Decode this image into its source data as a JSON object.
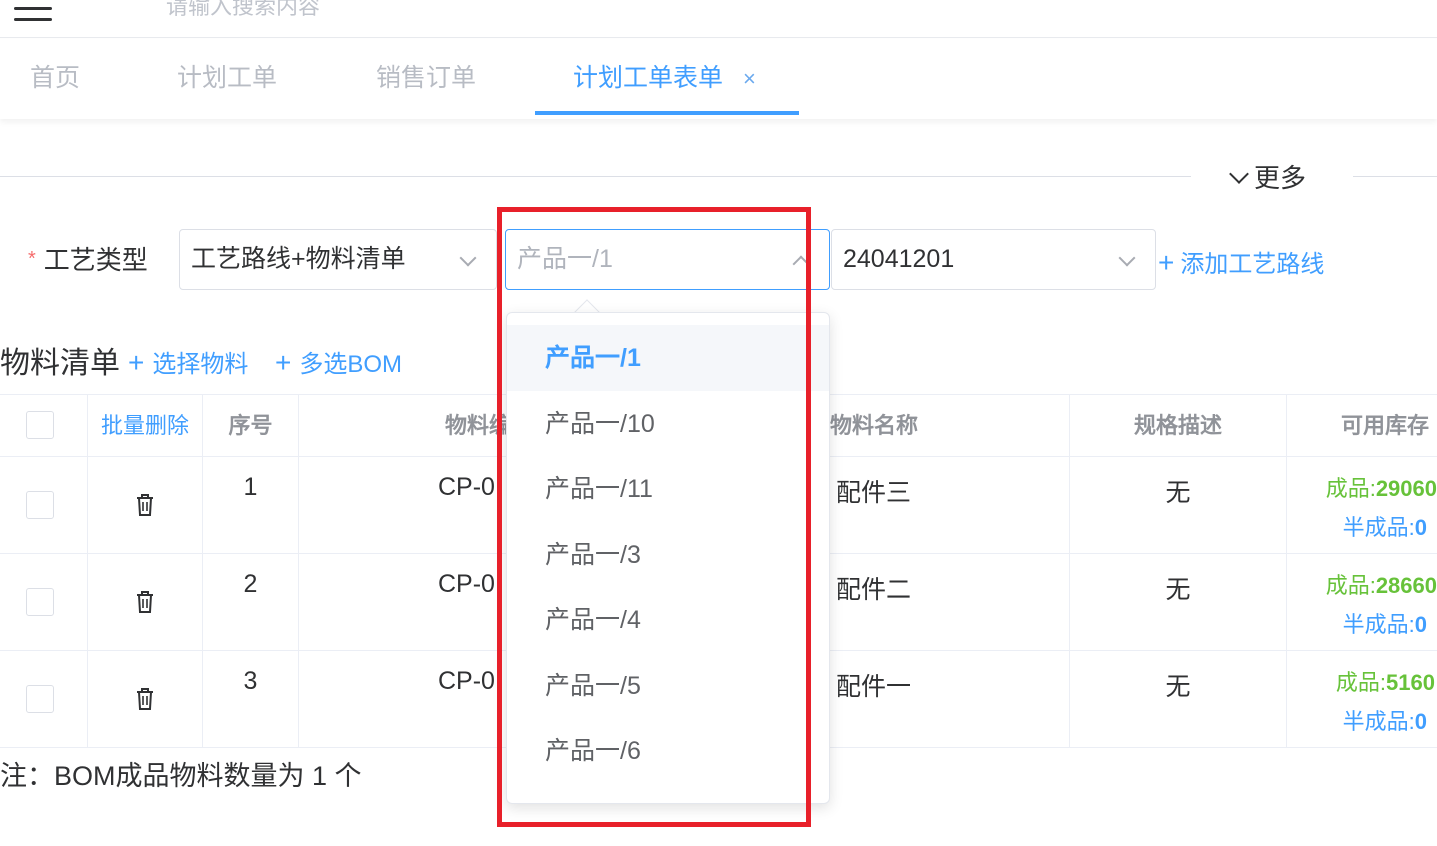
{
  "header": {
    "search_placeholder": "请输入搜索内容"
  },
  "tabs": [
    {
      "label": "首页"
    },
    {
      "label": "计划工单"
    },
    {
      "label": "销售订单"
    },
    {
      "label": "计划工单表单",
      "close": "×"
    }
  ],
  "more_label": "更多",
  "form": {
    "required_mark": "*",
    "label": "工艺类型",
    "route_select": "工艺路线+物料清单",
    "product_select_placeholder": "产品一/1",
    "code_select": "24041201",
    "add_route": "添加工艺路线",
    "plus": "+"
  },
  "section": {
    "title": "物料清单",
    "select_material": "选择物料",
    "multi_bom": "多选BOM"
  },
  "table": {
    "headers": {
      "batch_delete": "批量删除",
      "index": "序号",
      "code": "物料编",
      "name": "物料名称",
      "spec": "规格描述",
      "stock": "可用库存"
    },
    "rows": [
      {
        "index": "1",
        "code": "CP-0",
        "name": "配件三",
        "spec": "无",
        "finished_label": "成品:",
        "finished_value": "29060",
        "semi_label": "半成品:",
        "semi_value": "0"
      },
      {
        "index": "2",
        "code": "CP-0",
        "name": "配件二",
        "spec": "无",
        "finished_label": "成品:",
        "finished_value": "28660",
        "semi_label": "半成品:",
        "semi_value": "0"
      },
      {
        "index": "3",
        "code": "CP-0",
        "name": "配件一",
        "spec": "无",
        "finished_label": "成品:",
        "finished_value": "5160",
        "semi_label": "半成品:",
        "semi_value": "0"
      }
    ]
  },
  "note": "注：BOM成品物料数量为 1 个",
  "dropdown": {
    "options": [
      "产品一/1",
      "产品一/10",
      "产品一/11",
      "产品一/3",
      "产品一/4",
      "产品一/5",
      "产品一/6"
    ],
    "selected_index": 0
  },
  "colors": {
    "accent": "#409eff",
    "highlight": "#e8202a",
    "stock_green": "#67c23a"
  }
}
